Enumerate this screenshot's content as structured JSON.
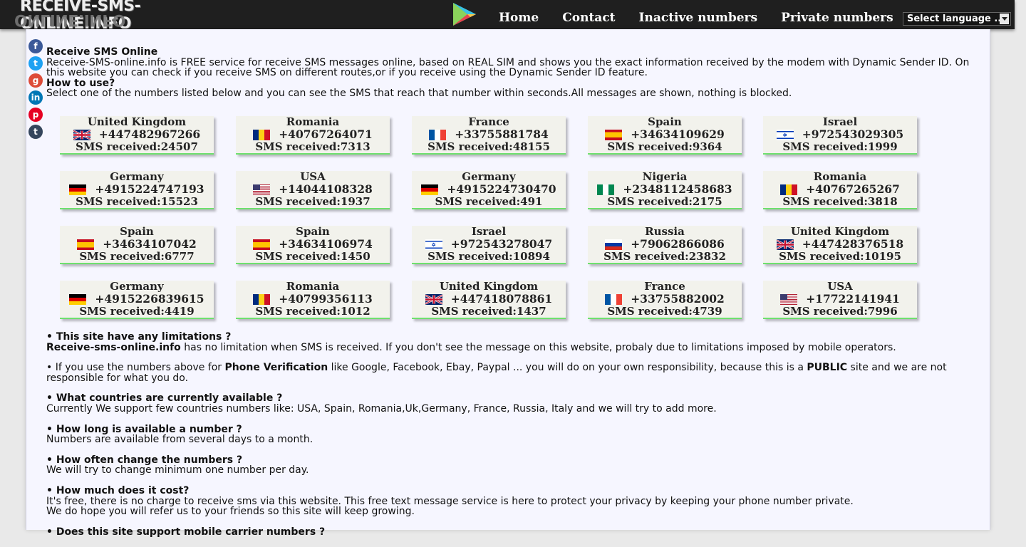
{
  "header": {
    "logo": "RECEIVE-SMS-ONLINE.INFO",
    "nav": [
      "Home",
      "Contact",
      "Inactive numbers",
      "Private numbers"
    ],
    "language_select": "Select language .."
  },
  "social_icons": [
    "facebook-icon",
    "twitter-icon",
    "google-plus-icon",
    "linkedin-icon",
    "pinterest-icon",
    "tumblr-icon"
  ],
  "intro": {
    "title": "Receive SMS Online",
    "text": "Receive-SMS-online.info is FREE service for receive SMS messages online, based on REAL SIM and shows you the exact information received by the modem with Dynamic Sender ID. On this website you can check if you receive SMS on different routes,or if you receive using the Dynamic Sender ID feature.",
    "howto_title": "How to use?",
    "howto_text": "Select one of the numbers listed below and you can see the SMS that reach that number within seconds.All messages are shown, nothing is blocked."
  },
  "numbers": [
    {
      "country": "United Kingdom",
      "flag": "uk",
      "number": "+447482967266",
      "received": "SMS received:24507"
    },
    {
      "country": "Romania",
      "flag": "ro",
      "number": "+40767264071",
      "received": "SMS received:7313"
    },
    {
      "country": "France",
      "flag": "fr",
      "number": "+33755881784",
      "received": "SMS received:48155"
    },
    {
      "country": "Spain",
      "flag": "es",
      "number": "+34634109629",
      "received": "SMS received:9364"
    },
    {
      "country": "Israel",
      "flag": "il",
      "number": "+972543029305",
      "received": "SMS received:1999"
    },
    {
      "country": "Germany",
      "flag": "de",
      "number": "+4915224747193",
      "received": "SMS received:15523"
    },
    {
      "country": "USA",
      "flag": "us",
      "number": "+14044108328",
      "received": "SMS received:1937"
    },
    {
      "country": "Germany",
      "flag": "de",
      "number": "+4915224730470",
      "received": "SMS received:491"
    },
    {
      "country": "Nigeria",
      "flag": "ng",
      "number": "+2348112458683",
      "received": "SMS received:2175"
    },
    {
      "country": "Romania",
      "flag": "ro",
      "number": "+40767265267",
      "received": "SMS received:3818"
    },
    {
      "country": "Spain",
      "flag": "es",
      "number": "+34634107042",
      "received": "SMS received:6777"
    },
    {
      "country": "Spain",
      "flag": "es",
      "number": "+34634106974",
      "received": "SMS received:1450"
    },
    {
      "country": "Israel",
      "flag": "il",
      "number": "+972543278047",
      "received": "SMS received:10894"
    },
    {
      "country": "Russia",
      "flag": "ru",
      "number": "+79062866086",
      "received": "SMS received:23832"
    },
    {
      "country": "United Kingdom",
      "flag": "uk",
      "number": "+447428376518",
      "received": "SMS received:10195"
    },
    {
      "country": "Germany",
      "flag": "de",
      "number": "+4915226839615",
      "received": "SMS received:4419"
    },
    {
      "country": "Romania",
      "flag": "ro",
      "number": "+40799356113",
      "received": "SMS received:1012"
    },
    {
      "country": "United Kingdom",
      "flag": "uk",
      "number": "+447418078861",
      "received": "SMS received:1437"
    },
    {
      "country": "France",
      "flag": "fr",
      "number": "+33755882002",
      "received": "SMS received:4739"
    },
    {
      "country": "USA",
      "flag": "us",
      "number": "+17722141941",
      "received": "SMS received:7996"
    }
  ],
  "faq": {
    "q1": "• This site have any limitations ?",
    "a1_bold": "Receive-sms-online.info",
    "a1": " has no limitation when SMS is received. If you don't see the message on this website, probaly due to limitations imposed by mobile operators.",
    "p2_a": "• If you use the numbers above for ",
    "p2_b": "Phone Verification",
    "p2_c": " like Google, Facebook, Ebay, Paypal ... you will do on your own responsibility, because this is a ",
    "p2_d": "PUBLIC",
    "p2_e": " site and we are not responsible for what you do.",
    "q3": "• What countries are currently available ?",
    "a3": "Currently We support few countries numbers like: USA, Spain, Romania,Uk,Germany, France, Russia, Italy and we will try to add more.",
    "q4": "• How long is available a number ?",
    "a4": "Numbers are available from several days to a month.",
    "q5": "• How often change the numbers ?",
    "a5": "We will try to change minimum one number per day.",
    "q6": "• How much does it cost?",
    "a6a": "It's free, there is no charge to receive sms via this website. This free text message service is here to protect your privacy by keeping your phone number private.",
    "a6b": "We do hope you will refer us to your friends so this site will keep growing.",
    "q7": "• Does this site support mobile carrier numbers ?"
  },
  "colors": {
    "header_bg": "#1f1f1f",
    "card_bg": "#f2f2ec",
    "card_accent": "#6ee06e",
    "page_bg": "#f6f6ff"
  }
}
